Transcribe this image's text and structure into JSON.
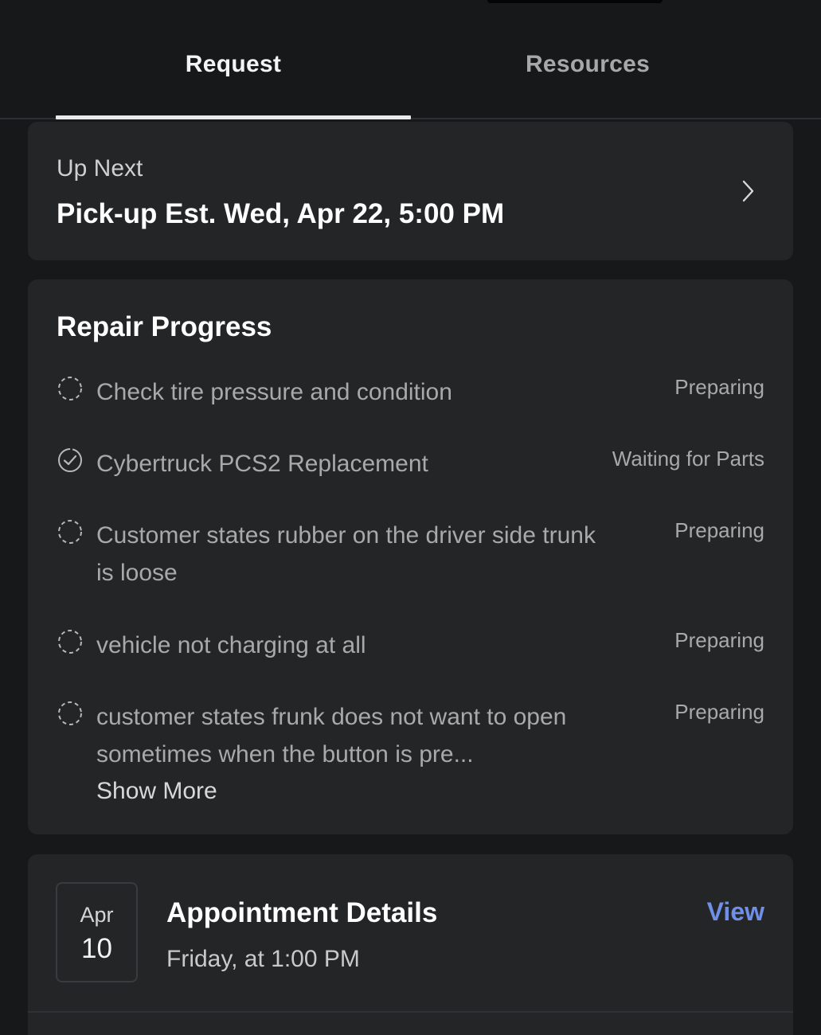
{
  "tabs": {
    "request": "Request",
    "resources": "Resources"
  },
  "up_next": {
    "label": "Up Next",
    "value": "Pick-up Est. Wed, Apr 22, 5:00 PM",
    "chevron_icon": "chevron-right-icon"
  },
  "repair_progress": {
    "title": "Repair Progress",
    "items": [
      {
        "icon": "dashed-circle-icon",
        "text": "Check tire pressure and condition",
        "status": "Preparing"
      },
      {
        "icon": "check-circle-icon",
        "text": "Cybertruck PCS2 Replacement",
        "status": "Waiting for Parts"
      },
      {
        "icon": "dashed-circle-icon",
        "text": "Customer states rubber on the driver side trunk is loose",
        "status": "Preparing"
      },
      {
        "icon": "dashed-circle-icon",
        "text": "vehicle not charging at all",
        "status": "Preparing"
      },
      {
        "icon": "dashed-circle-icon",
        "text": "customer states frunk does not want to open sometimes when the button is pre...",
        "status": "Preparing",
        "more_label": "Show More"
      }
    ]
  },
  "appointment": {
    "month": "Apr",
    "day": "10",
    "title": "Appointment Details",
    "time": "Friday, at 1:00 PM",
    "view_label": "View"
  },
  "colors": {
    "background": "#17181a",
    "card": "#242527",
    "text_primary": "#ffffff",
    "text_secondary": "#a9a9a9",
    "accent_link": "#6f8fe8"
  }
}
